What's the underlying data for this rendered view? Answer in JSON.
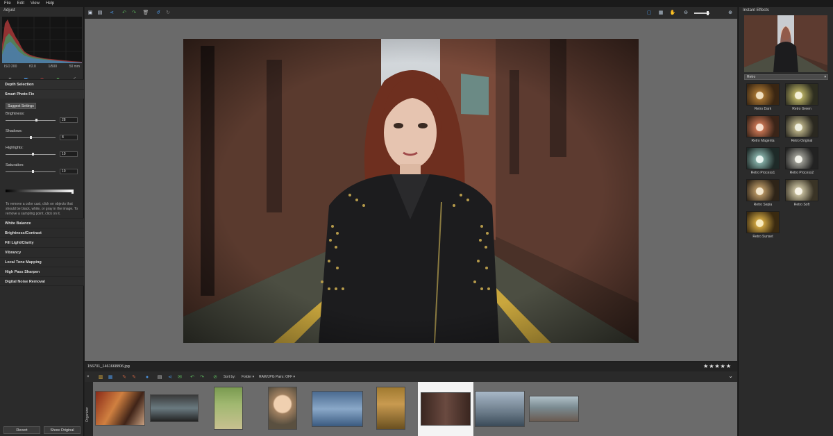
{
  "menu": [
    "File",
    "Edit",
    "View",
    "Help"
  ],
  "left_panel": {
    "title": "Adjust",
    "exif": [
      "ISO 200",
      "f/2.0",
      "1/500",
      "50 mm"
    ],
    "tools": [
      "crop-icon",
      "straighten-icon",
      "red-eye-icon",
      "clone-icon",
      "dropper-icon"
    ],
    "depth_selection": "Depth Selection",
    "smart_photo_fix": "Smart Photo Fix",
    "suggest_button": "Suggest Settings",
    "sliders": [
      {
        "label": "Brightness:",
        "value": "28",
        "fraction": 0.62
      },
      {
        "label": "Shadows:",
        "value": "8",
        "fraction": 0.5
      },
      {
        "label": "Highlights:",
        "value": "10",
        "fraction": 0.55
      },
      {
        "label": "Saturation:",
        "value": "10",
        "fraction": 0.55
      }
    ],
    "help_text": "To remove a color cast, click on objects that should be black, white, or gray in the image. To remove a sampling point, click on it.",
    "categories": [
      "White Balance",
      "Brightness/Contrast",
      "Fill Light/Clarity",
      "Vibrancy",
      "Local Tone Mapping",
      "High Pass Sharpen",
      "Digital Noise Removal"
    ],
    "revert_button": "Revert",
    "show_original_button": "Show Original"
  },
  "right_panel": {
    "title": "Instant Effects",
    "category_select": "Retro",
    "effects": [
      "Retro Dark",
      "Retro Green",
      "Retro Magenta",
      "Retro Original",
      "Retro Process1",
      "Retro Process2",
      "Retro Sepia",
      "Retro Soft",
      "Retro Sunset"
    ]
  },
  "organizer": {
    "filename": "156701_1461668806.jpg",
    "rating": "★★★★★",
    "sort_label": "Sort by:",
    "sort_value": "Folder",
    "raw_pairs": "RAW/JPG Pairs: OFF",
    "side_label": "Organizer"
  },
  "colors": {
    "background": "#1f1f1f",
    "panel": "#2b2b2b",
    "canvas": "#6a6a6a",
    "accent_blue": "#4a90d9",
    "accent_green": "#5bb55b"
  }
}
